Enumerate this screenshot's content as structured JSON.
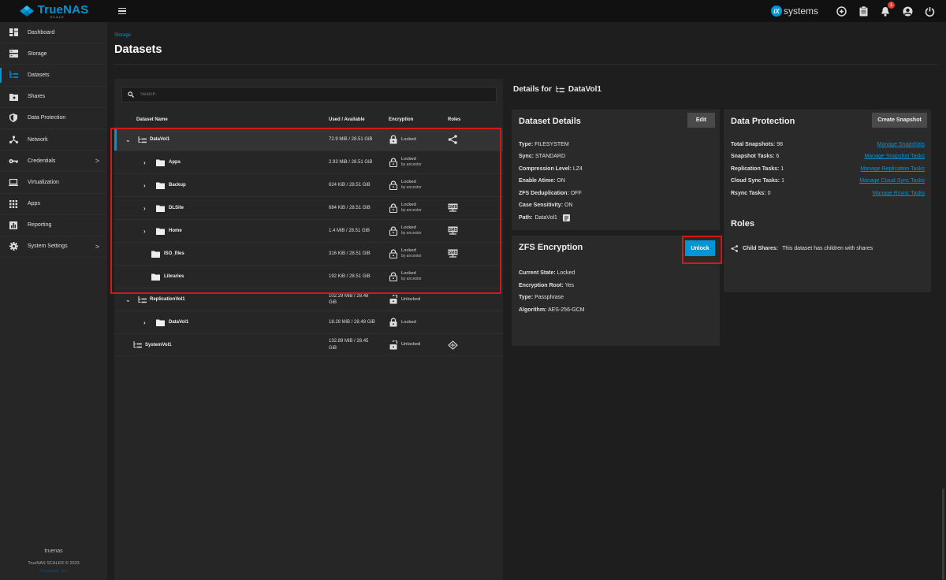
{
  "brand": {
    "name": "TrueNAS",
    "edition": "SCALE",
    "vendor": "systems",
    "vendor_mark": "iX"
  },
  "topbar": {
    "alerts_count": "1"
  },
  "sidebar": {
    "items": [
      {
        "label": "Dashboard",
        "icon": "dashboard-icon"
      },
      {
        "label": "Storage",
        "icon": "storage-icon"
      },
      {
        "label": "Datasets",
        "icon": "datasets-icon",
        "active": true
      },
      {
        "label": "Shares",
        "icon": "shares-icon"
      },
      {
        "label": "Data Protection",
        "icon": "shield-icon"
      },
      {
        "label": "Network",
        "icon": "network-icon"
      },
      {
        "label": "Credentials",
        "icon": "key-icon",
        "chevron": ">"
      },
      {
        "label": "Virtualization",
        "icon": "laptop-icon"
      },
      {
        "label": "Apps",
        "icon": "apps-grid-icon"
      },
      {
        "label": "Reporting",
        "icon": "chart-icon"
      },
      {
        "label": "System Settings",
        "icon": "gear-icon",
        "chevron": ">"
      }
    ],
    "hostname": "truenas",
    "copyright": "TrueNAS SCALE® © 2023",
    "company": "iXsystems, Inc."
  },
  "page": {
    "breadcrumb": "Storage",
    "title": "Datasets"
  },
  "search": {
    "placeholder": "Search"
  },
  "tree": {
    "headers": {
      "name": "Dataset Name",
      "used": "Used / Available",
      "encryption": "Encryption",
      "roles": "Roles"
    },
    "rows": [
      {
        "name": "DataVol1",
        "used": "72.9 MiB / 28.51 GiB",
        "enc": "Locked",
        "enc_sub": "",
        "lock": "locked",
        "role": "share"
      },
      {
        "name": "Apps",
        "used": "2.93 MiB / 28.51 GiB",
        "enc": "Locked",
        "enc_sub": "by ancestor",
        "lock": "locked",
        "role": ""
      },
      {
        "name": "Backup",
        "used": "624 KiB / 28.51 GiB",
        "enc": "Locked",
        "enc_sub": "by ancestor",
        "lock": "locked",
        "role": ""
      },
      {
        "name": "DLSite",
        "used": "684 KiB / 28.51 GiB",
        "enc": "Locked",
        "enc_sub": "by ancestor",
        "lock": "locked",
        "role": "smb"
      },
      {
        "name": "Home",
        "used": "1.4 MiB / 28.51 GiB",
        "enc": "Locked",
        "enc_sub": "by ancestor",
        "lock": "locked",
        "role": "smb"
      },
      {
        "name": "ISO_files",
        "used": "316 KiB / 28.51 GiB",
        "enc": "Locked",
        "enc_sub": "by ancestor",
        "lock": "locked",
        "role": "smb"
      },
      {
        "name": "Libraries",
        "used": "192 KiB / 28.51 GiB",
        "enc": "Locked",
        "enc_sub": "by ancestor",
        "lock": "locked",
        "role": ""
      },
      {
        "name": "ReplicationVol1",
        "used": "102.29 MiB / 28.48 GiB",
        "enc": "Unlocked",
        "enc_sub": "",
        "lock": "unlocked",
        "role": ""
      },
      {
        "name": "DataVol1",
        "used": "18.28 MiB / 28.48 GiB",
        "enc": "Locked",
        "enc_sub": "",
        "lock": "locked",
        "role": ""
      },
      {
        "name": "SystemVol1",
        "used": "132.89 MiB / 28.45 GiB",
        "enc": "Unlocked",
        "enc_sub": "",
        "lock": "unlocked",
        "role": "system"
      }
    ]
  },
  "details": {
    "heading": "Details for",
    "dataset": "DataVol1",
    "dataset_details": {
      "title": "Dataset Details",
      "edit_label": "Edit",
      "fields": [
        {
          "k": "Type:",
          "v": "FILESYSTEM"
        },
        {
          "k": "Sync:",
          "v": "STANDARD"
        },
        {
          "k": "Compression Level:",
          "v": "LZ4"
        },
        {
          "k": "Enable Atime:",
          "v": "ON"
        },
        {
          "k": "ZFS Deduplication:",
          "v": "OFF"
        },
        {
          "k": "Case Sensitivity:",
          "v": "ON"
        },
        {
          "k": "Path:",
          "v": "DataVol1"
        }
      ]
    },
    "data_protection": {
      "title": "Data Protection",
      "button": "Create Snapshot",
      "rows": [
        {
          "k": "Total Snapshots:",
          "v": "98",
          "link": "Manage Snapshots"
        },
        {
          "k": "Snapshot Tasks:",
          "v": "6",
          "link": "Manage Snapshot Tasks"
        },
        {
          "k": "Replication Tasks:",
          "v": "1",
          "link": "Manage Replication Tasks"
        },
        {
          "k": "Cloud Sync Tasks:",
          "v": "1",
          "link": "Manage Cloud Sync Tasks"
        },
        {
          "k": "Rsync Tasks:",
          "v": "0",
          "link": "Manage Rsync Tasks"
        }
      ]
    },
    "zfs_encryption": {
      "title": "ZFS Encryption",
      "button": "Unlock",
      "fields": [
        {
          "k": "Current State:",
          "v": "Locked"
        },
        {
          "k": "Encryption Root:",
          "v": "Yes"
        },
        {
          "k": "Type:",
          "v": "Passphrase"
        },
        {
          "k": "Algorithm:",
          "v": "AES-256-GCM"
        }
      ]
    },
    "roles": {
      "title": "Roles",
      "label": "Child Shares:",
      "value": "This dataset has children with shares"
    }
  },
  "colors": {
    "accent": "#0095d5",
    "highlight": "#d01a1a"
  }
}
